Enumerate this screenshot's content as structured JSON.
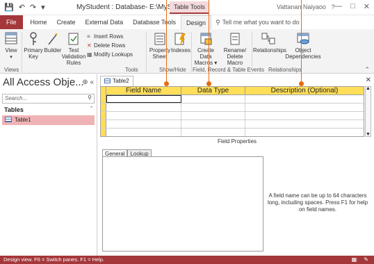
{
  "titlebar": {
    "icons": [
      "save-icon",
      "undo-icon",
      "redo-icon",
      "customize-icon"
    ],
    "title": "MyStudent : Database- E:\\MyStudent.acc...",
    "context_tools": "Table Tools",
    "user": "Vattanan Naiyaoo",
    "help": "?",
    "window_controls": [
      "minimize-icon",
      "restore-icon",
      "close-icon"
    ]
  },
  "ribbon_tabs": {
    "file": "File",
    "items": [
      "Home",
      "Create",
      "External Data",
      "Database Tools",
      "Design"
    ],
    "active": "Design",
    "tell_me": "Tell me what you want to do"
  },
  "ribbon": {
    "view": {
      "label1": "View",
      "label2": ""
    },
    "primary_key": {
      "label1": "Primary",
      "label2": "Key"
    },
    "builder": {
      "label1": "Builder",
      "label2": ""
    },
    "test_validation": {
      "label1": "Test Validation",
      "label2": "Rules"
    },
    "insert_rows": "Insert Rows",
    "delete_rows": "Delete Rows",
    "modify_lookups": "Modify Lookups",
    "property_sheet": {
      "label1": "Property",
      "label2": "Sheet"
    },
    "indexes": {
      "label1": "Indexes",
      "label2": ""
    },
    "create_data_macros": {
      "label1": "Create Data",
      "label2": "Macros"
    },
    "rename_delete_macro": {
      "label1": "Rename/",
      "label2": "Delete Macro"
    },
    "relationships": {
      "label1": "Relationships",
      "label2": ""
    },
    "object_dependencies": {
      "label1": "Object",
      "label2": "Dependencies"
    },
    "groups": {
      "views": "Views",
      "tools": "Tools",
      "show_hide": "Show/Hide",
      "field_record_table_events": "Field, Record & Table Events",
      "relationships": "Relationships"
    }
  },
  "nav": {
    "title": "All Access Obje...",
    "search_placeholder": "Search...",
    "group": "Tables",
    "items": [
      "Table1"
    ]
  },
  "document": {
    "tab": "Table2",
    "columns": [
      "Field Name",
      "Data Type",
      "Description (Optional)"
    ],
    "row_count": 6,
    "field_properties": "Field Properties",
    "property_tabs": [
      "General",
      "Lookup"
    ],
    "hint": "A field name can be up to 64 characters long, including spaces. Press F1 for help on field names."
  },
  "status": {
    "text": "Design view.  F6 = Switch panes.  F1 = Help."
  }
}
